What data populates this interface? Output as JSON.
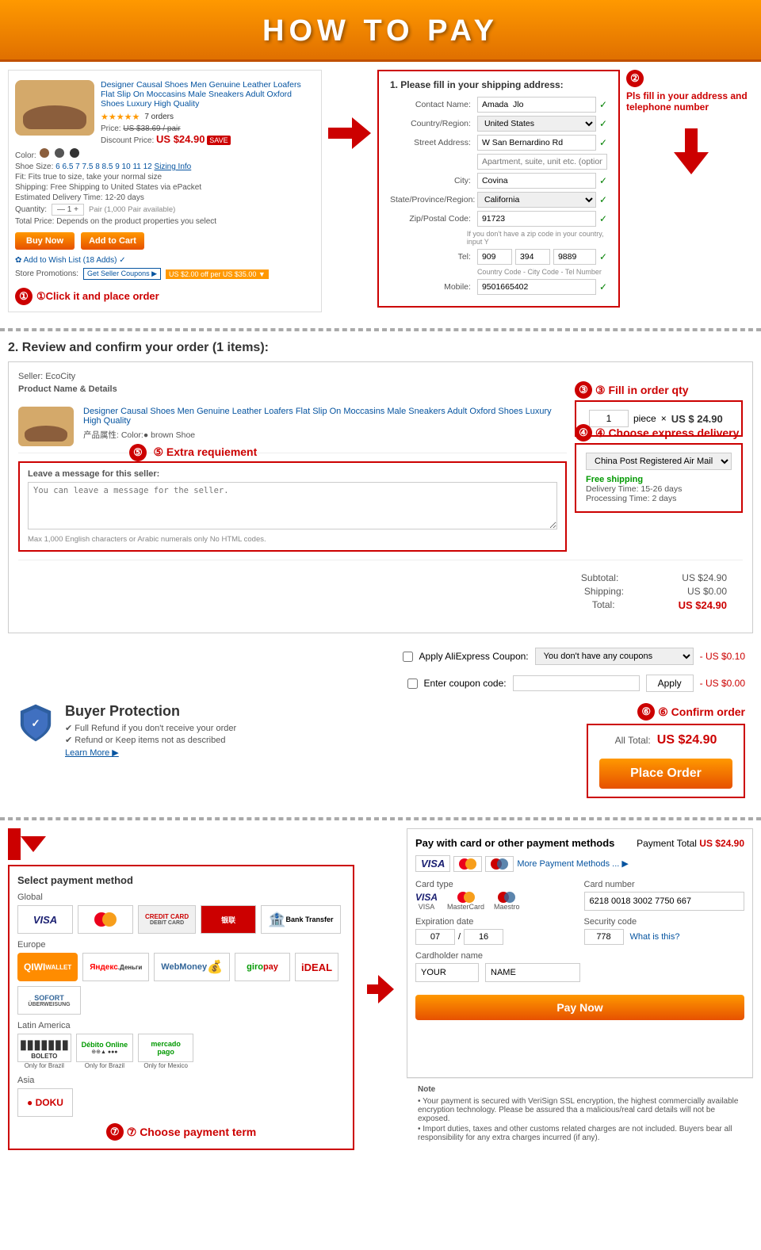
{
  "header": {
    "title": "HOW TO PAY"
  },
  "step1": {
    "label": "①Click it and place order",
    "product": {
      "title": "Designer Causal Shoes Men Genuine Leather Loafers Flat Slip On Moccasins Male Sneakers Adult Oxford Shoes Luxury High Quality",
      "rating": "5.0",
      "reviews": "7 orders",
      "price_original": "US $38.69 / pair",
      "price_current": "US $24.90",
      "discount": "SAVE",
      "color_label": "Color:",
      "shoe_size_label": "Shoe Size:",
      "fit_label": "Fit:",
      "fit_value": "Fits true to size, take your normal size",
      "shipping_label": "Shipping:",
      "shipping_value": "Free Shipping to United States via ePacket",
      "delivery_label": "Estimated Delivery Time: 12-20 days",
      "quantity_label": "Quantity:",
      "total_label": "Total Price:",
      "buy_now": "Buy Now",
      "add_to_cart": "Add to Cart"
    }
  },
  "step2_note": "Pls fill in your address and telephone number",
  "shipping_form": {
    "title": "1. Please fill in your shipping address:",
    "contact_name_label": "Contact Name:",
    "contact_name_value": "Amada  Jlo",
    "country_label": "Country/Region:",
    "country_value": "United States",
    "street_label": "Street Address:",
    "street_value": "W San Bernardino Rd",
    "apt_placeholder": "Apartment, suite, unit etc. (optional)",
    "city_label": "City:",
    "city_value": "Covina",
    "state_label": "State/Province/Region:",
    "state_value": "California",
    "zip_label": "Zip/Postal Code:",
    "zip_value": "91723",
    "zip_hint": "If you don't have a zip code in your country, input Y",
    "tel_label": "Tel:",
    "tel_value1": "909",
    "tel_value2": "394",
    "tel_value3": "9889",
    "tel_hint": "Country Code - City Code - Tel Number",
    "mobile_label": "Mobile:",
    "mobile_value": "9501665402"
  },
  "section2_title": "2. Review and confirm your order (1 items):",
  "order": {
    "seller": "Seller: EcoCity",
    "col_header": "Product Name & Details",
    "product_name": "Designer Causal Shoes Men Genuine Leather Loafers Flat Slip On Moccasins Male Sneakers Adult Oxford Shoes Luxury High Quality",
    "product_props": "产品属性: Color:● brown    Shoe",
    "step3_label": "③ Fill in order qty",
    "qty_value": "1",
    "qty_unit": "piece",
    "multiply": "×",
    "unit_price": "US $ 24.90",
    "step4_label": "④ Choose express delivery",
    "delivery_method": "China Post Registered Air Mail",
    "free_shipping": "Free shipping",
    "delivery_time": "Delivery Time: 15-26 days",
    "processing_time": "Processing Time: 2 days",
    "step5_label": "⑤ Extra requiement",
    "message_label": "Leave a message for this seller:",
    "message_placeholder": "You can leave a message for the seller.",
    "message_hint": "Max  1,000 English characters or Arabic numerals only  No HTML codes.",
    "subtotal_label": "Subtotal:",
    "subtotal_value": "US $24.90",
    "shipping_label": "Shipping:",
    "shipping_value": "US $0.00",
    "total_label": "Total:",
    "total_value": "US $24.90"
  },
  "coupon": {
    "aliexpress_label": "Apply AliExpress Coupon:",
    "aliexpress_placeholder": "You don't have any coupons",
    "aliexpress_discount": "- US $0.10",
    "coupon_code_label": "Enter coupon code:",
    "coupon_discount": "- US $0.00",
    "apply_btn": "Apply"
  },
  "confirm": {
    "step6_label": "⑥ Confirm order",
    "all_total_label": "All Total:",
    "all_total_price": "US $24.90",
    "place_order_btn": "Place Order",
    "buyer_protection_title": "Buyer Protection",
    "bp_item1": "✔ Full Refund if you don't receive your order",
    "bp_item2": "✔ Refund or Keep items not as described",
    "bp_link": "Learn More ▶"
  },
  "payment": {
    "title_left": "Select payment method",
    "title_right": "Pay with card or other payment methods",
    "payment_total_label": "Payment Total",
    "payment_total_value": "US $24.90",
    "global_label": "Global",
    "europe_label": "Europe",
    "latin_label": "Latin America",
    "asia_label": "Asia",
    "bank_transfer": "Bank Transfer",
    "card_type_label": "Card type",
    "card_number_label": "Card number",
    "card_number_value": "6218 0018 3002 7750 667",
    "exp_date_label": "Expiration date",
    "exp_month": "07",
    "slash": "/",
    "exp_year": "16",
    "security_label": "Security code",
    "security_value": "778",
    "what_is_this": "What is this?",
    "cardholder_label": "Cardholder name",
    "cardholder_first": "YOUR",
    "cardholder_last": "NAME",
    "pay_now_btn": "Pay Now",
    "step7_label": "⑦ Choose payment term",
    "visa_label": "VISA",
    "mastercard_label": "MasterCard",
    "maestro_label": "Maestro",
    "more_payment": "More Payment Methods ... ▶",
    "credit_label": "Credit card\nDebit card"
  },
  "notes": {
    "title": "Note",
    "note1": "• Your payment is secured with VeriSign SSL encryption, the highest commercially available encryption technology. Please be assured tha a malicious/real card details will not be exposed.",
    "note2": "• Import duties, taxes and other customs related charges are not included. Buyers bear all responsibility for any extra charges incurred (if any)."
  }
}
